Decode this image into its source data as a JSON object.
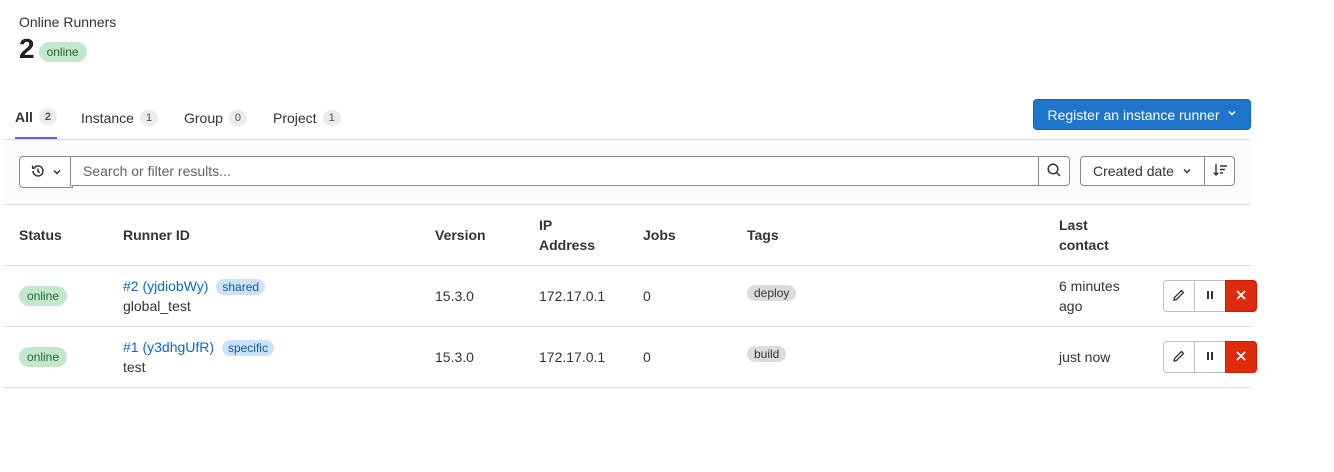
{
  "stats": {
    "label": "Online Runners",
    "count": "2",
    "status": "online"
  },
  "tabs": [
    {
      "label": "All",
      "count": "2"
    },
    {
      "label": "Instance",
      "count": "1"
    },
    {
      "label": "Group",
      "count": "0"
    },
    {
      "label": "Project",
      "count": "1"
    }
  ],
  "register_button": {
    "label": "Register an instance runner"
  },
  "filter": {
    "placeholder": "Search or filter results...",
    "sort_label": "Created date"
  },
  "table": {
    "headers": {
      "status": "Status",
      "runner_id": "Runner ID",
      "version": "Version",
      "ip": "IP Address",
      "jobs": "Jobs",
      "tags": "Tags",
      "last_contact": "Last contact"
    },
    "rows": [
      {
        "status": "online",
        "id": "#2 (yjdiobWy)",
        "type": "shared",
        "description": "global_test",
        "version": "15.3.0",
        "ip": "172.17.0.1",
        "jobs": "0",
        "tag": "deploy",
        "last_contact": "6 minutes ago"
      },
      {
        "status": "online",
        "id": "#1 (y3dhgUfR)",
        "type": "specific",
        "description": "test",
        "version": "15.3.0",
        "ip": "172.17.0.1",
        "jobs": "0",
        "tag": "build",
        "last_contact": "just now"
      }
    ]
  },
  "colors": {
    "primary": "#1f75cb",
    "danger": "#dd2b0e",
    "online_bg": "#c3e6cd",
    "tab_active": "#6666c4"
  }
}
